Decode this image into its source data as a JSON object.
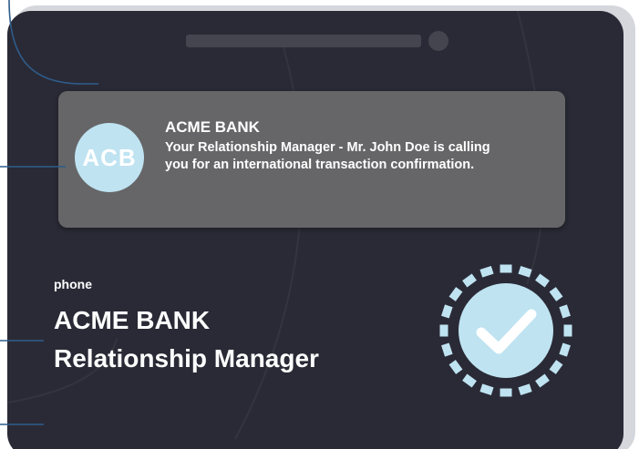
{
  "colors": {
    "phone_body": "#2a2a36",
    "notification_bg": "#666668",
    "avatar_bg": "#bfe3f1",
    "accent_blue": "#bfe3f1",
    "connector_line": "#2e5c8a",
    "text": "#ffffff"
  },
  "notification": {
    "avatar_text": "ACB",
    "title": "ACME BANK",
    "message": "Your Relationship Manager - Mr. John Doe is calling you for an international transaction confirmation."
  },
  "caller": {
    "label": "phone",
    "name_line1": "ACME BANK",
    "name_line2": "Relationship Manager"
  },
  "icons": {
    "verified": "verified-check-icon",
    "avatar": "bank-avatar-icon"
  }
}
